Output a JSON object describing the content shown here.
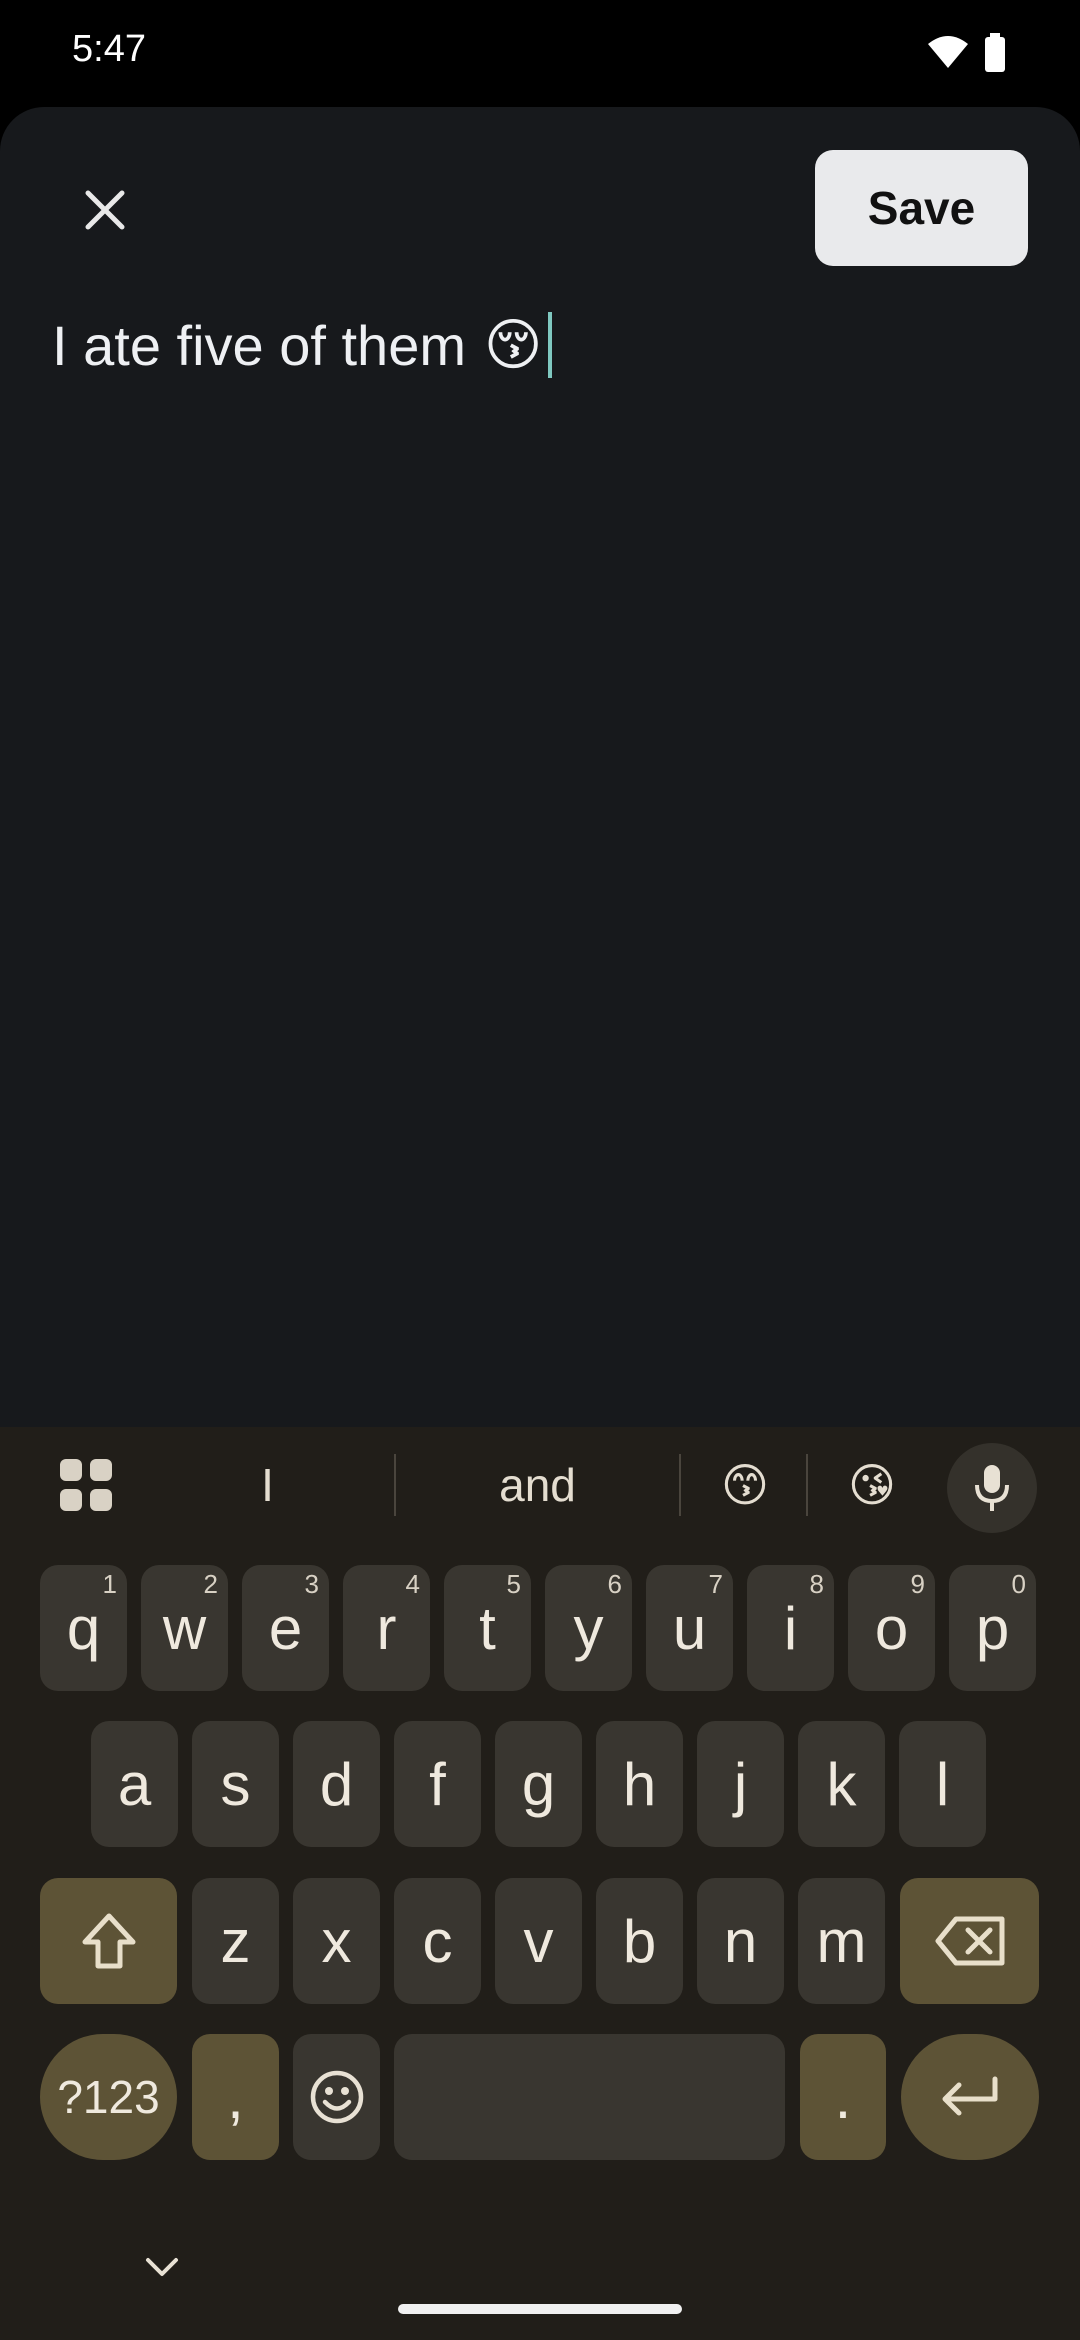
{
  "status_bar": {
    "time": "5:47"
  },
  "editor": {
    "save_label": "Save",
    "text": "I ate five of them",
    "emoji": "😚"
  },
  "keyboard": {
    "suggestions": [
      "I",
      "and",
      "😙",
      "😘"
    ],
    "row1": [
      {
        "key": "q",
        "hint": "1"
      },
      {
        "key": "w",
        "hint": "2"
      },
      {
        "key": "e",
        "hint": "3"
      },
      {
        "key": "r",
        "hint": "4"
      },
      {
        "key": "t",
        "hint": "5"
      },
      {
        "key": "y",
        "hint": "6"
      },
      {
        "key": "u",
        "hint": "7"
      },
      {
        "key": "i",
        "hint": "8"
      },
      {
        "key": "o",
        "hint": "9"
      },
      {
        "key": "p",
        "hint": "0"
      }
    ],
    "row2": [
      "a",
      "s",
      "d",
      "f",
      "g",
      "h",
      "j",
      "k",
      "l"
    ],
    "row3": [
      "z",
      "x",
      "c",
      "v",
      "b",
      "n",
      "m"
    ],
    "symbols_label": "?123",
    "comma": ",",
    "period": "."
  },
  "colors": {
    "sheet_bg": "#17191c",
    "keyboard_bg": "#211e19",
    "key_bg": "#393630",
    "function_key_bg": "#5d5336",
    "caret": "#7fc8c0"
  }
}
